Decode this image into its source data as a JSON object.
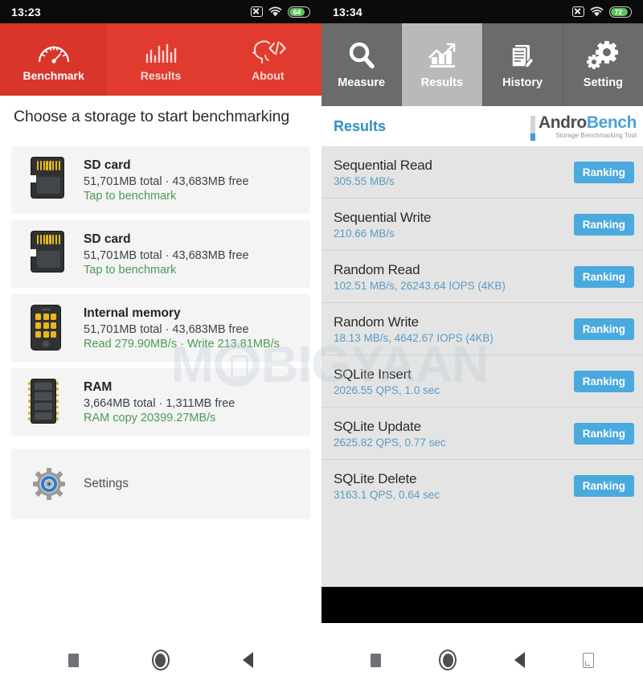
{
  "left": {
    "status": {
      "time": "13:23",
      "battery": "64",
      "icons": [
        "no-sim-icon",
        "wifi-icon",
        "battery-icon"
      ]
    },
    "tabs": [
      {
        "label": "Benchmark",
        "icon": "speedometer-icon",
        "active": true
      },
      {
        "label": "Results",
        "icon": "bar-chart-icon",
        "active": false
      },
      {
        "label": "About",
        "icon": "head-code-icon",
        "active": false
      }
    ],
    "title": "Choose a storage to start benchmarking",
    "storages": [
      {
        "icon": "sd-card-icon",
        "name": "SD card",
        "meta": "51,701MB total · 43,683MB free",
        "sub": "Tap to benchmark"
      },
      {
        "icon": "sd-card-icon",
        "name": "SD card",
        "meta": "51,701MB total · 43,683MB free",
        "sub": "Tap to benchmark"
      },
      {
        "icon": "phone-icon",
        "name": "Internal memory",
        "meta": "51,701MB total · 43,683MB free",
        "sub": "Read 279.90MB/s · Write 213.81MB/s"
      },
      {
        "icon": "ram-chip-icon",
        "name": "RAM",
        "meta": "3,664MB total · 1,311MB free",
        "sub": "RAM copy 20399.27MB/s"
      }
    ],
    "settings": {
      "label": "Settings",
      "icon": "gear-icon"
    }
  },
  "right": {
    "status": {
      "time": "13:34",
      "battery": "72",
      "icons": [
        "no-sim-icon",
        "wifi-icon",
        "battery-icon"
      ]
    },
    "tabs": [
      {
        "label": "Measure",
        "icon": "magnifier-icon",
        "active": false
      },
      {
        "label": "Results",
        "icon": "growth-chart-icon",
        "active": true
      },
      {
        "label": "History",
        "icon": "document-pencil-icon",
        "active": false
      },
      {
        "label": "Setting",
        "icon": "gears-icon",
        "active": false
      }
    ],
    "header": {
      "title": "Results",
      "logo_andro": "Andro",
      "logo_bench": "Bench",
      "logo_tagline": "Storage Benchmarking Tool"
    },
    "ranking_label": "Ranking",
    "results": [
      {
        "name": "Sequential Read",
        "value": "305.55 MB/s"
      },
      {
        "name": "Sequential Write",
        "value": "210.66 MB/s"
      },
      {
        "name": "Random Read",
        "value": "102.51 MB/s, 26243.64 IOPS (4KB)"
      },
      {
        "name": "Random Write",
        "value": "18.13 MB/s, 4642.67 IOPS (4KB)"
      },
      {
        "name": "SQLite Insert",
        "value": "2026.55 QPS, 1.0 sec"
      },
      {
        "name": "SQLite Update",
        "value": "2625.82 QPS, 0.77 sec"
      },
      {
        "name": "SQLite Delete",
        "value": "3163.1 QPS, 0.64 sec"
      }
    ]
  },
  "navbar": {
    "recents": "recents-square-icon",
    "home": "home-circle-icon",
    "back": "back-triangle-icon",
    "screenshot": "screenshot-icon"
  },
  "watermark": {
    "part1": "M",
    "part2": "BIGYAAN"
  },
  "colors": {
    "red_accent": "#e13b30",
    "gray_tabbar": "#6b6b6b",
    "blue_accent": "#4aaade",
    "green_text": "#4c9a54",
    "battery_green": "#5cc45c"
  }
}
